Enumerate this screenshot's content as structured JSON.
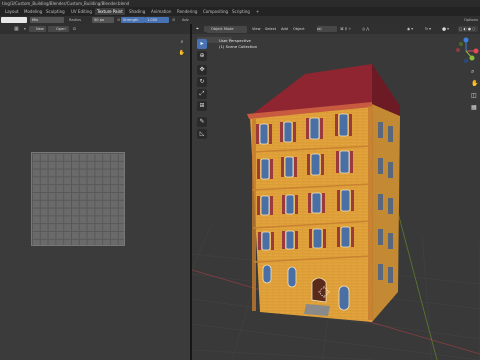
{
  "window": {
    "title": "ting/3/Custom_Building/Blender/Custom_Building/Blender.blend"
  },
  "workspace_tabs": [
    {
      "label": "Layout",
      "active": false
    },
    {
      "label": "Modeling",
      "active": false
    },
    {
      "label": "Sculpting",
      "active": false
    },
    {
      "label": "UV Editing",
      "active": false
    },
    {
      "label": "Texture Paint",
      "active": true
    },
    {
      "label": "Shading",
      "active": false
    },
    {
      "label": "Animation",
      "active": false
    },
    {
      "label": "Rendering",
      "active": false
    },
    {
      "label": "Compositing",
      "active": false
    },
    {
      "label": "Scripting",
      "active": false
    },
    {
      "label": "+",
      "active": false
    }
  ],
  "tool_settings": {
    "blend_mode": "Mix",
    "radius_label": "Radius",
    "radius_value": "50 px",
    "strength_label": "Strength",
    "strength_value": "1.000",
    "adv_label": "Adv",
    "options_label": "Options"
  },
  "image_editor": {
    "new_button": "New",
    "open_button": "Open"
  },
  "viewport": {
    "mode": "Object Mode",
    "menus": [
      "View",
      "Select",
      "Add",
      "Object"
    ],
    "transform_orientation": "Global",
    "overlay_line1": "User Perspective",
    "overlay_line2": "(1) Scene Collection"
  },
  "colors": {
    "accent": "#4772b3",
    "wall": "#e0a43c",
    "roof": "#8f2530",
    "shutter": "#9a3a3a",
    "glass": "#4a6fa5"
  }
}
